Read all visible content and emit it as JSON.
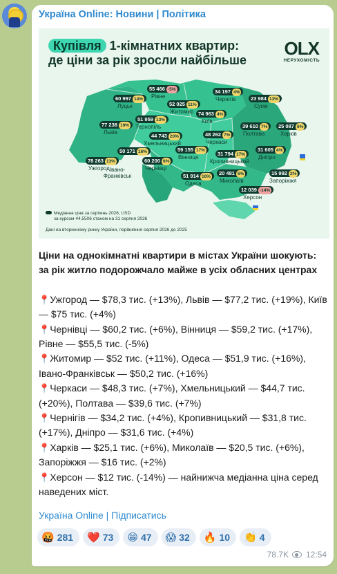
{
  "channel": {
    "name": "Україна Online: Новини | Політика"
  },
  "infographic": {
    "title_highlight": "Купівля",
    "title_rest": " 1-кімнатних квартир:",
    "title_line2": "де ціни за рік зросли найбільше",
    "brand": "OLX",
    "brand_sub": "НЕРУХОМІСТЬ",
    "legend_line1": "Медіанна ціна за серпень 2026, USD",
    "legend_line2": "за курсом 44,5506 станом на 31 серпня 2026",
    "note": "Дані на вторинному ринку України, порівняння серпня 2026 до 2025",
    "cities": [
      {
        "name": "Луцьк",
        "price": "60 997",
        "change": "14%",
        "neg": false
      },
      {
        "name": "Рівне",
        "price": "55 466",
        "change": "-5%",
        "neg": true
      },
      {
        "name": "Чернігів",
        "price": "34 197",
        "change": "4%",
        "neg": false
      },
      {
        "name": "Суми",
        "price": "23 984",
        "change": "13%",
        "neg": false
      },
      {
        "name": "Житомир",
        "price": "52 025",
        "change": "11%",
        "neg": false
      },
      {
        "name": "Київ",
        "price": "74 963",
        "change": "4%",
        "neg": false
      },
      {
        "name": "Тернопіль",
        "price": "51 959",
        "change": "13%",
        "neg": false
      },
      {
        "name": "Львів",
        "price": "77 238",
        "change": "19%",
        "neg": false
      },
      {
        "name": "Хмельницький",
        "price": "44 743",
        "change": "20%",
        "neg": false
      },
      {
        "name": "Черкаси",
        "price": "48 262",
        "change": "7%",
        "neg": false
      },
      {
        "name": "Полтава",
        "price": "39 610",
        "change": "7%",
        "neg": false
      },
      {
        "name": "Харків",
        "price": "25 087",
        "change": "6%",
        "neg": false
      },
      {
        "name": "Івано-Франківськ",
        "price": "50 171",
        "change": "16%",
        "neg": false
      },
      {
        "name": "Вінниця",
        "price": "59 155",
        "change": "17%",
        "neg": false
      },
      {
        "name": "Кропивницький",
        "price": "31 794",
        "change": "17%",
        "neg": false
      },
      {
        "name": "Дніпро",
        "price": "31 605",
        "change": "4%",
        "neg": false
      },
      {
        "name": "Ужгород",
        "price": "78 263",
        "change": "13%",
        "neg": false
      },
      {
        "name": "Чернівці",
        "price": "60 200",
        "change": "6%",
        "neg": false
      },
      {
        "name": "Одеса",
        "price": "51 914",
        "change": "16%",
        "neg": false
      },
      {
        "name": "Миколаїв",
        "price": "20 481",
        "change": "6%",
        "neg": false
      },
      {
        "name": "Запоріжжя",
        "price": "15 992",
        "change": "2%",
        "neg": false
      },
      {
        "name": "Херсон",
        "price": "12 039",
        "change": "-14%",
        "neg": true
      }
    ]
  },
  "post": {
    "lead": "Ціни на однокімнатні квартири в містах України шокують: за рік житло подорожчало майже в усіх обласних центрах",
    "pin": "📍",
    "lines": [
      "Ужгород — $78,3 тис. (+13%), Львів — $77,2 тис. (+19%), Київ — $75 тис. (+4%)",
      "Чернівці — $60,2 тис. (+6%), Вінниця — $59,2 тис. (+17%), Рівне — $55,5 тис. (-5%)",
      "Житомир — $52 тис. (+11%), Одеса — $51,9 тис. (+16%), Івано-Франківськ — $50,2 тис. (+16%)",
      "Черкаси — $48,3 тис. (+7%), Хмельницький — $44,7 тис. (+20%), Полтава — $39,6 тис. (+7%)",
      "Чернігів — $34,2 тис. (+4%), Кропивницький — $31,8 тис. (+17%), Дніпро — $31,6 тис. (+4%)",
      "Харків — $25,1 тис. (+6%), Миколаїв — $20,5 тис. (+6%), Запоріжжя — $16 тис. (+2%)",
      "Херсон — $12 тис. (-14%) — найнижча медіанна ціна серед наведених міст."
    ],
    "subscribe_link": "Україна Online | Підписатись"
  },
  "reactions": [
    {
      "emoji": "🤬",
      "count": "281"
    },
    {
      "emoji": "❤️",
      "count": "73"
    },
    {
      "emoji": "😁",
      "count": "47"
    },
    {
      "emoji": "😱",
      "count": "32"
    },
    {
      "emoji": "🔥",
      "count": "10"
    },
    {
      "emoji": "👏",
      "count": "4"
    }
  ],
  "meta": {
    "views": "78.7K",
    "time": "12:54"
  },
  "colors": {
    "background": "#b9cc8f",
    "link": "#2f8ad0",
    "map_green": "#2fb386",
    "map_dark": "#0f3a2e",
    "highlight": "#3dd6b0"
  }
}
